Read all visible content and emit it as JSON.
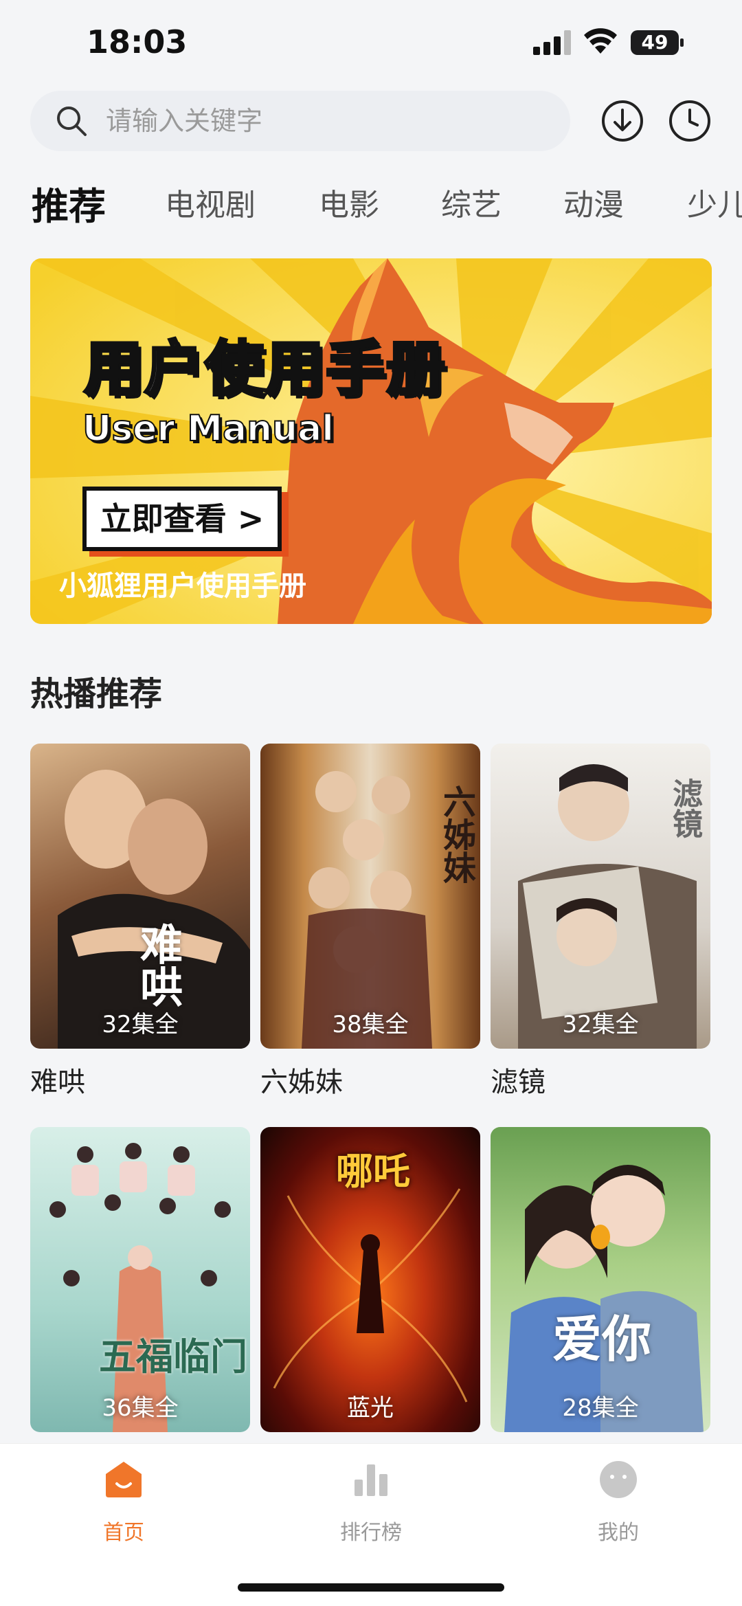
{
  "status": {
    "time": "18:03",
    "battery": "49"
  },
  "search": {
    "placeholder": "请输入关键字"
  },
  "tabs": [
    {
      "label": "推荐",
      "active": true
    },
    {
      "label": "电视剧"
    },
    {
      "label": "电影"
    },
    {
      "label": "综艺"
    },
    {
      "label": "动漫"
    },
    {
      "label": "少儿"
    }
  ],
  "banner": {
    "title": "用户使用手册",
    "subtitle": "User Manual",
    "cta": "立即查看 >",
    "caption": "小狐狸用户使用手册"
  },
  "section": {
    "title": "热播推荐"
  },
  "items": [
    {
      "title": "难哄",
      "badge": "32集全",
      "art": "难哄",
      "bg": [
        "#c9a27a",
        "#3b2a22"
      ]
    },
    {
      "title": "六姊妹",
      "badge": "38集全",
      "art": "六姊妹",
      "bg": [
        "#a06a3a",
        "#4a2e1e"
      ]
    },
    {
      "title": "滤镜",
      "badge": "32集全",
      "art": "滤镜",
      "bg": [
        "#e8e6e2",
        "#9a8b7c"
      ]
    },
    {
      "title": "",
      "badge": "36集全",
      "art": "五福临门",
      "bg": [
        "#bfe6e0",
        "#7fb8b0"
      ]
    },
    {
      "title": "",
      "badge": "蓝光",
      "art": "哪吒",
      "bg": [
        "#2a0a06",
        "#b4300e"
      ]
    },
    {
      "title": "",
      "badge": "28集全",
      "art": "爱你",
      "bg": [
        "#8fbf6a",
        "#c9dfb0"
      ]
    }
  ],
  "nav": [
    {
      "label": "首页",
      "icon": "home-icon",
      "active": true
    },
    {
      "label": "排行榜",
      "icon": "ranking-icon"
    },
    {
      "label": "我的",
      "icon": "profile-icon"
    }
  ],
  "colors": {
    "accent": "#f0762a",
    "bannerYellow": "#f7d632",
    "foxOrange": "#e4692a"
  }
}
